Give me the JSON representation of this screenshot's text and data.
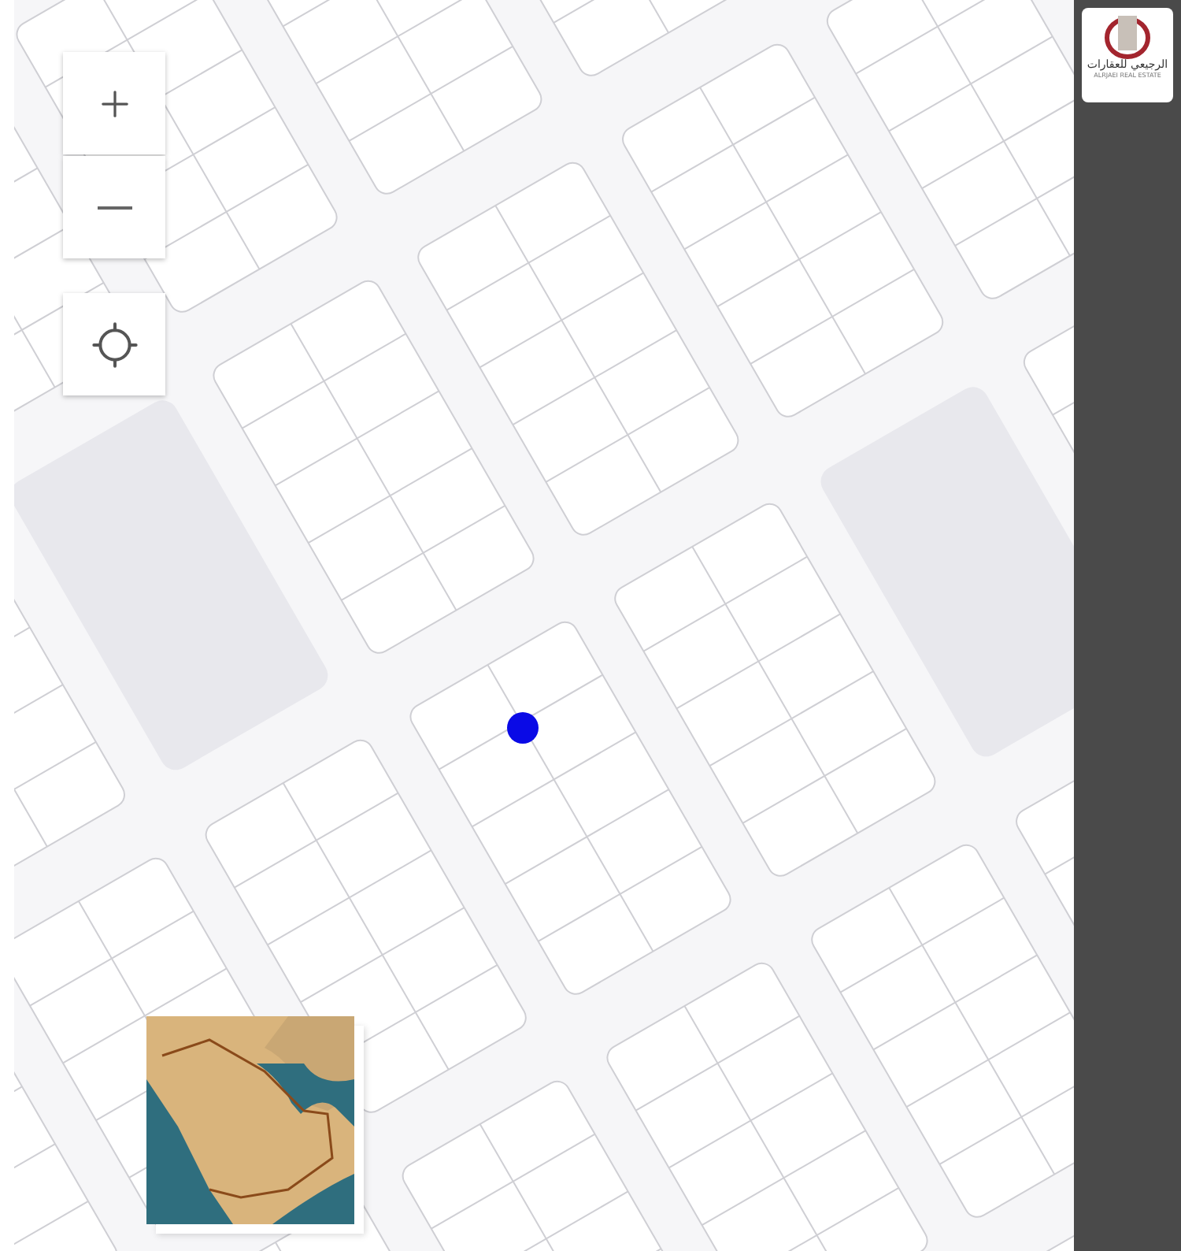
{
  "logo": {
    "name_ar": "الرجيعي للعقارات",
    "name_en": "ALRJAEI REAL ESTATE"
  },
  "map_controls": [
    {
      "kind": "zoom-in"
    },
    {
      "kind": "zoom-out"
    },
    {
      "kind": "locate"
    }
  ]
}
